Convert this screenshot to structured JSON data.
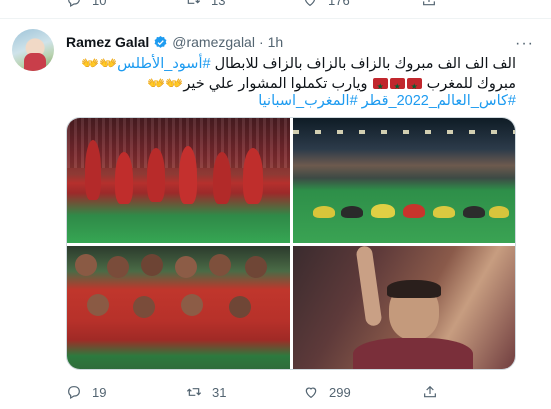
{
  "top_actions": {
    "reply_count": "10",
    "retweet_count": "13",
    "like_count": "176"
  },
  "tweet": {
    "display_name": "Ramez Galal",
    "handle": "@ramezgalal",
    "separator": "·",
    "time": "1h",
    "line1_text": "الف الف الف مبروك بالزاف بالزاف بالزاف للابطال ",
    "line1_tag": "#أسود_الأطلس",
    "line1_emoji": "👐👐",
    "line2_text_a": "مبروك للمغرب ",
    "line2_text_b": " ويارب تكملوا المشوار علي خير",
    "line2_emoji": "👐👐",
    "line3_tags": "#كاس_العالم_2022_قطر #المغرب_اسبانيا"
  },
  "media": {
    "photos": [
      {
        "name": "players-celebrating-photo"
      },
      {
        "name": "players-prostrating-photo"
      },
      {
        "name": "team-lineup-photo"
      },
      {
        "name": "goalkeeper-celebrating-photo"
      }
    ]
  },
  "bottom_actions": {
    "reply_count": "19",
    "retweet_count": "31",
    "like_count": "299"
  },
  "colors": {
    "link": "#1d9bf0",
    "muted": "#536471",
    "verified": "#1d9bf0",
    "morocco_red": "#c1272d",
    "morocco_green": "#006233"
  },
  "icons": [
    "reply-icon",
    "retweet-icon",
    "like-icon",
    "share-icon",
    "verified-badge-icon",
    "more-options-icon"
  ]
}
